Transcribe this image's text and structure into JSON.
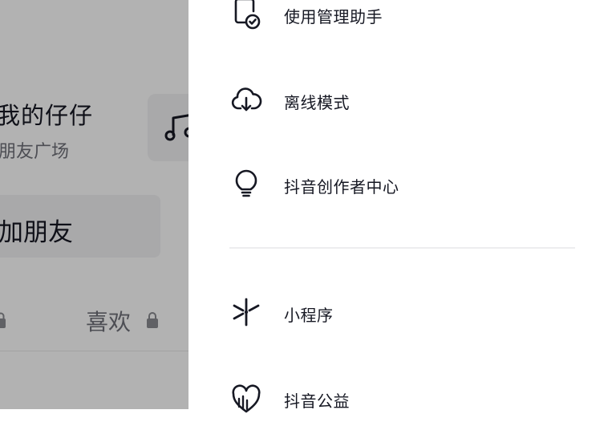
{
  "background": {
    "profile_name": "我的仔仔",
    "profile_sub": "朋友广场",
    "add_friend": "加朋友",
    "tab_likes": "喜欢"
  },
  "drawer": {
    "items": [
      {
        "label": "使用管理助手",
        "icon": "phone-check-icon"
      },
      {
        "label": "离线模式",
        "icon": "cloud-download-icon"
      },
      {
        "label": "抖音创作者中心",
        "icon": "lightbulb-icon"
      },
      {
        "label": "小程序",
        "icon": "mini-program-icon"
      },
      {
        "label": "抖音公益",
        "icon": "heart-charity-icon"
      }
    ]
  },
  "colors": {
    "text": "#161823",
    "secondary": "#6f7079",
    "divider": "#ededef",
    "overlay": "rgba(0,0,0,0.30)"
  }
}
